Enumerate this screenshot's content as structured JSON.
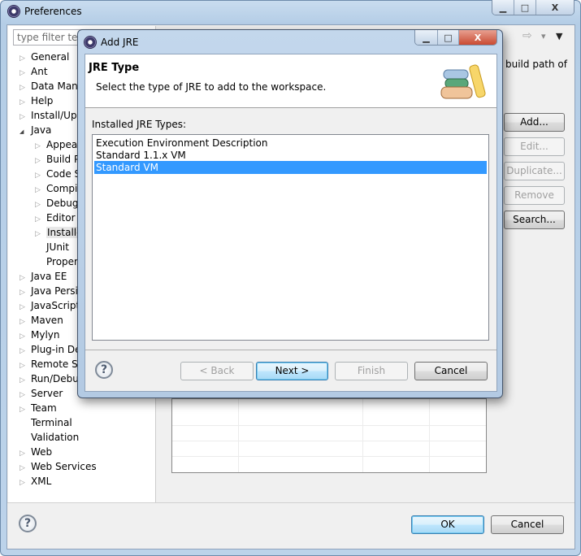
{
  "preferences": {
    "title": "Preferences",
    "filter_placeholder": "type filter text",
    "tree": [
      {
        "label": "General",
        "level": 0,
        "arrow": "collapsed"
      },
      {
        "label": "Ant",
        "level": 0,
        "arrow": "collapsed"
      },
      {
        "label": "Data Mana",
        "level": 0,
        "arrow": "collapsed"
      },
      {
        "label": "Help",
        "level": 0,
        "arrow": "collapsed"
      },
      {
        "label": "Install/Upd",
        "level": 0,
        "arrow": "collapsed"
      },
      {
        "label": "Java",
        "level": 0,
        "arrow": "expanded"
      },
      {
        "label": "Appear",
        "level": 1,
        "arrow": "collapsed"
      },
      {
        "label": "Build P",
        "level": 1,
        "arrow": "collapsed"
      },
      {
        "label": "Code S",
        "level": 1,
        "arrow": "collapsed"
      },
      {
        "label": "Compi",
        "level": 1,
        "arrow": "collapsed"
      },
      {
        "label": "Debug",
        "level": 1,
        "arrow": "collapsed"
      },
      {
        "label": "Editor",
        "level": 1,
        "arrow": "collapsed"
      },
      {
        "label": "Installe",
        "level": 1,
        "arrow": "collapsed",
        "selected": true
      },
      {
        "label": "JUnit",
        "level": 1,
        "arrow": "none"
      },
      {
        "label": "Proper",
        "level": 1,
        "arrow": "none"
      },
      {
        "label": "Java EE",
        "level": 0,
        "arrow": "collapsed"
      },
      {
        "label": "Java Persis",
        "level": 0,
        "arrow": "collapsed"
      },
      {
        "label": "JavaScript",
        "level": 0,
        "arrow": "collapsed"
      },
      {
        "label": "Maven",
        "level": 0,
        "arrow": "collapsed"
      },
      {
        "label": "Mylyn",
        "level": 0,
        "arrow": "collapsed"
      },
      {
        "label": "Plug-in De",
        "level": 0,
        "arrow": "collapsed"
      },
      {
        "label": "Remote Sy",
        "level": 0,
        "arrow": "collapsed"
      },
      {
        "label": "Run/Debu",
        "level": 0,
        "arrow": "collapsed"
      },
      {
        "label": "Server",
        "level": 0,
        "arrow": "collapsed"
      },
      {
        "label": "Team",
        "level": 0,
        "arrow": "collapsed"
      },
      {
        "label": "Terminal",
        "level": 0,
        "arrow": "none"
      },
      {
        "label": "Validation",
        "level": 0,
        "arrow": "none"
      },
      {
        "label": "Web",
        "level": 0,
        "arrow": "collapsed"
      },
      {
        "label": "Web Services",
        "level": 0,
        "arrow": "collapsed"
      },
      {
        "label": "XML",
        "level": 0,
        "arrow": "collapsed"
      }
    ],
    "page_text_fragment": "build path of",
    "side_buttons": [
      {
        "label": "Add...",
        "enabled": true
      },
      {
        "label": "Edit...",
        "enabled": false
      },
      {
        "label": "Duplicate...",
        "enabled": false
      },
      {
        "label": "Remove",
        "enabled": false
      },
      {
        "label": "Search...",
        "enabled": true
      }
    ],
    "ok_label": "OK",
    "cancel_label": "Cancel",
    "help_glyph": "?"
  },
  "dialog": {
    "title": "Add JRE",
    "header_title": "JRE Type",
    "header_desc": "Select the type of JRE to add to the workspace.",
    "list_label": "Installed JRE Types:",
    "items": [
      "Execution Environment Description",
      "Standard 1.1.x VM",
      "Standard VM"
    ],
    "selected_index": 2,
    "back_label": "< Back",
    "next_label": "Next >",
    "finish_label": "Finish",
    "cancel_label": "Cancel",
    "help_glyph": "?",
    "selection_color": "#3399ff"
  }
}
